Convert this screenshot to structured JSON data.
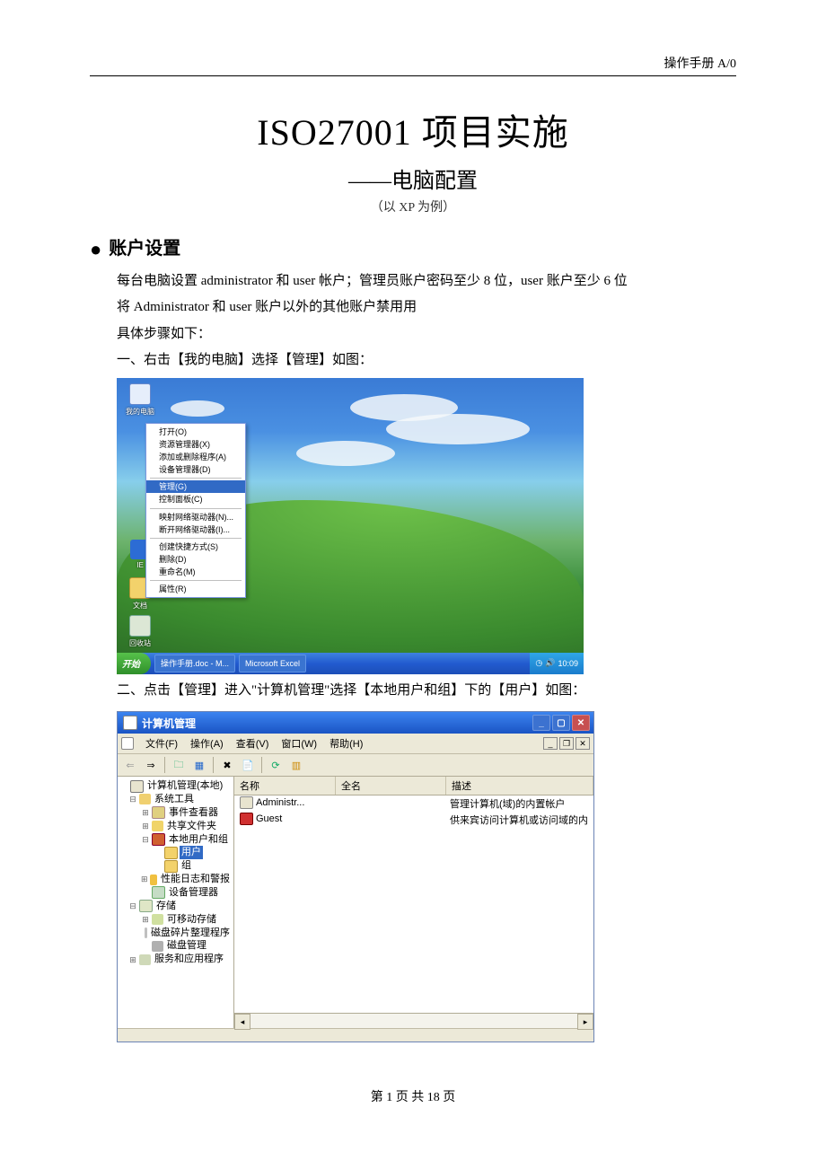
{
  "header": {
    "right": "操作手册  A/0"
  },
  "title": "ISO27001 项目实施",
  "subtitle": "——电脑配置",
  "subnote": "（以 XP 为例）",
  "section": {
    "bullet": "●",
    "heading": "账户设置"
  },
  "para1": "每台电脑设置 administrator 和 user 帐户；管理员账户密码至少 8 位，user 账户至少 6 位",
  "para2": "将 Administrator 和 user 账户以外的其他账户禁用用",
  "para3": "具体步骤如下：",
  "step1": "一、右击【我的电脑】选择【管理】如图：",
  "step2": "二、点击【管理】进入\"计算机管理\"选择【本地用户和组】下的【用户】如图：",
  "desktop": {
    "icons": [
      {
        "label": "我的电脑"
      },
      {
        "label": "IE"
      },
      {
        "label": "文档"
      },
      {
        "label": "回收站"
      }
    ],
    "context_menu": {
      "items": [
        "打开(O)",
        "资源管理器(X)",
        "添加或删除程序(A)",
        "设备管理器(D)"
      ],
      "selected": "管理(G)",
      "items2": [
        "控制面板(C)"
      ],
      "items3": [
        "映射网络驱动器(N)...",
        "断开网络驱动器(I)..."
      ],
      "items4": [
        "创建快捷方式(S)",
        "删除(D)",
        "重命名(M)"
      ],
      "items5": [
        "属性(R)"
      ]
    },
    "taskbar": {
      "start": "开始",
      "tasks": [
        "操作手册.doc - M...",
        "Microsoft Excel"
      ],
      "clock": "10:09"
    }
  },
  "mmc": {
    "title": "计算机管理",
    "menus": {
      "file": "文件(F)",
      "action": "操作(A)",
      "view": "查看(V)",
      "window": "窗口(W)",
      "help": "帮助(H)"
    },
    "tree": {
      "root": "计算机管理(本地)",
      "sys_tools": "系统工具",
      "event": "事件查看器",
      "shared": "共享文件夹",
      "local_ug": "本地用户和组",
      "users": "用户",
      "groups": "组",
      "perf": "性能日志和警报",
      "device": "设备管理器",
      "storage": "存储",
      "removable": "可移动存储",
      "defrag": "磁盘碎片整理程序",
      "diskmg": "磁盘管理",
      "services": "服务和应用程序"
    },
    "list": {
      "col_name": "名称",
      "col_full": "全名",
      "col_desc": "描述",
      "rows": [
        {
          "name": "Administr...",
          "full": "",
          "desc": "管理计算机(域)的内置帐户"
        },
        {
          "name": "Guest",
          "full": "",
          "desc": "供来宾访问计算机或访问域的内"
        }
      ]
    }
  },
  "footer": "第 1 页  共 18 页"
}
